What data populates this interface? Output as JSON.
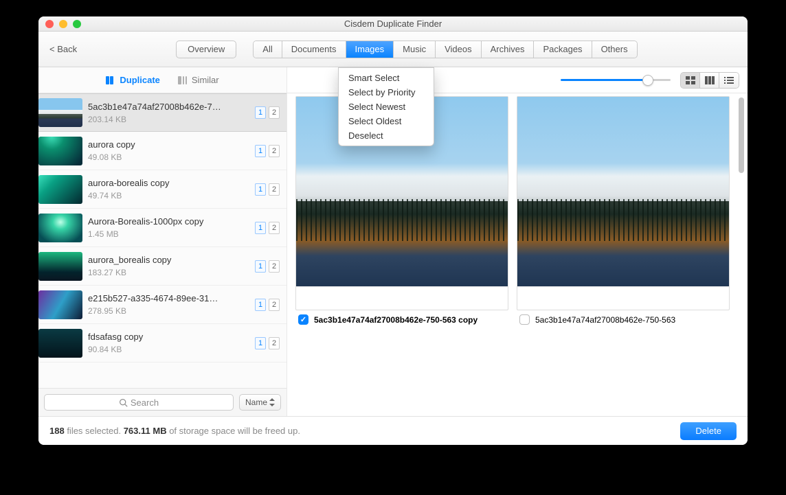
{
  "window_title": "Cisdem Duplicate Finder",
  "toolbar": {
    "back_label": "< Back",
    "overview_label": "Overview",
    "categories": [
      "All",
      "Documents",
      "Images",
      "Music",
      "Videos",
      "Archives",
      "Packages",
      "Others"
    ],
    "active_category_index": 2
  },
  "sidebar": {
    "tab_duplicate": "Duplicate",
    "tab_similar": "Similar",
    "active_tab": "duplicate",
    "items": [
      {
        "name": "5ac3b1e47a74af27008b462e-7…",
        "size": "203.14 KB",
        "count1": "1",
        "count2": "2",
        "thumb": "mountain",
        "selected": true
      },
      {
        "name": "aurora copy",
        "size": "49.08 KB",
        "count1": "1",
        "count2": "2",
        "thumb": "aurora"
      },
      {
        "name": "aurora-borealis copy",
        "size": "49.74 KB",
        "count1": "1",
        "count2": "2",
        "thumb": "aurora2"
      },
      {
        "name": "Aurora-Borealis-1000px copy",
        "size": "1.45 MB",
        "count1": "1",
        "count2": "2",
        "thumb": "aurora3"
      },
      {
        "name": "aurora_borealis copy",
        "size": "183.27 KB",
        "count1": "1",
        "count2": "2",
        "thumb": "aurora4"
      },
      {
        "name": "e215b527-a335-4674-89ee-31…",
        "size": "278.95 KB",
        "count1": "1",
        "count2": "2",
        "thumb": "aurora5"
      },
      {
        "name": "fdsafasg copy",
        "size": "90.84 KB",
        "count1": "1",
        "count2": "2",
        "thumb": "aurora6"
      }
    ],
    "search_placeholder": "Search",
    "sort_label": "Name"
  },
  "context_menu": {
    "items": [
      "Smart Select",
      "Select by Priority",
      "Select Newest",
      "Select Oldest",
      "Deselect"
    ]
  },
  "preview": {
    "slider_value": 80,
    "cards": [
      {
        "label": "5ac3b1e47a74af27008b462e-750-563 copy",
        "checked": true,
        "bold": true
      },
      {
        "label": "5ac3b1e47a74af27008b462e-750-563",
        "checked": false,
        "bold": false
      }
    ]
  },
  "status": {
    "count": "188",
    "text_a": " files selected. ",
    "size": "763.11 MB",
    "text_b": " of storage space will be freed up.",
    "delete_label": "Delete"
  }
}
